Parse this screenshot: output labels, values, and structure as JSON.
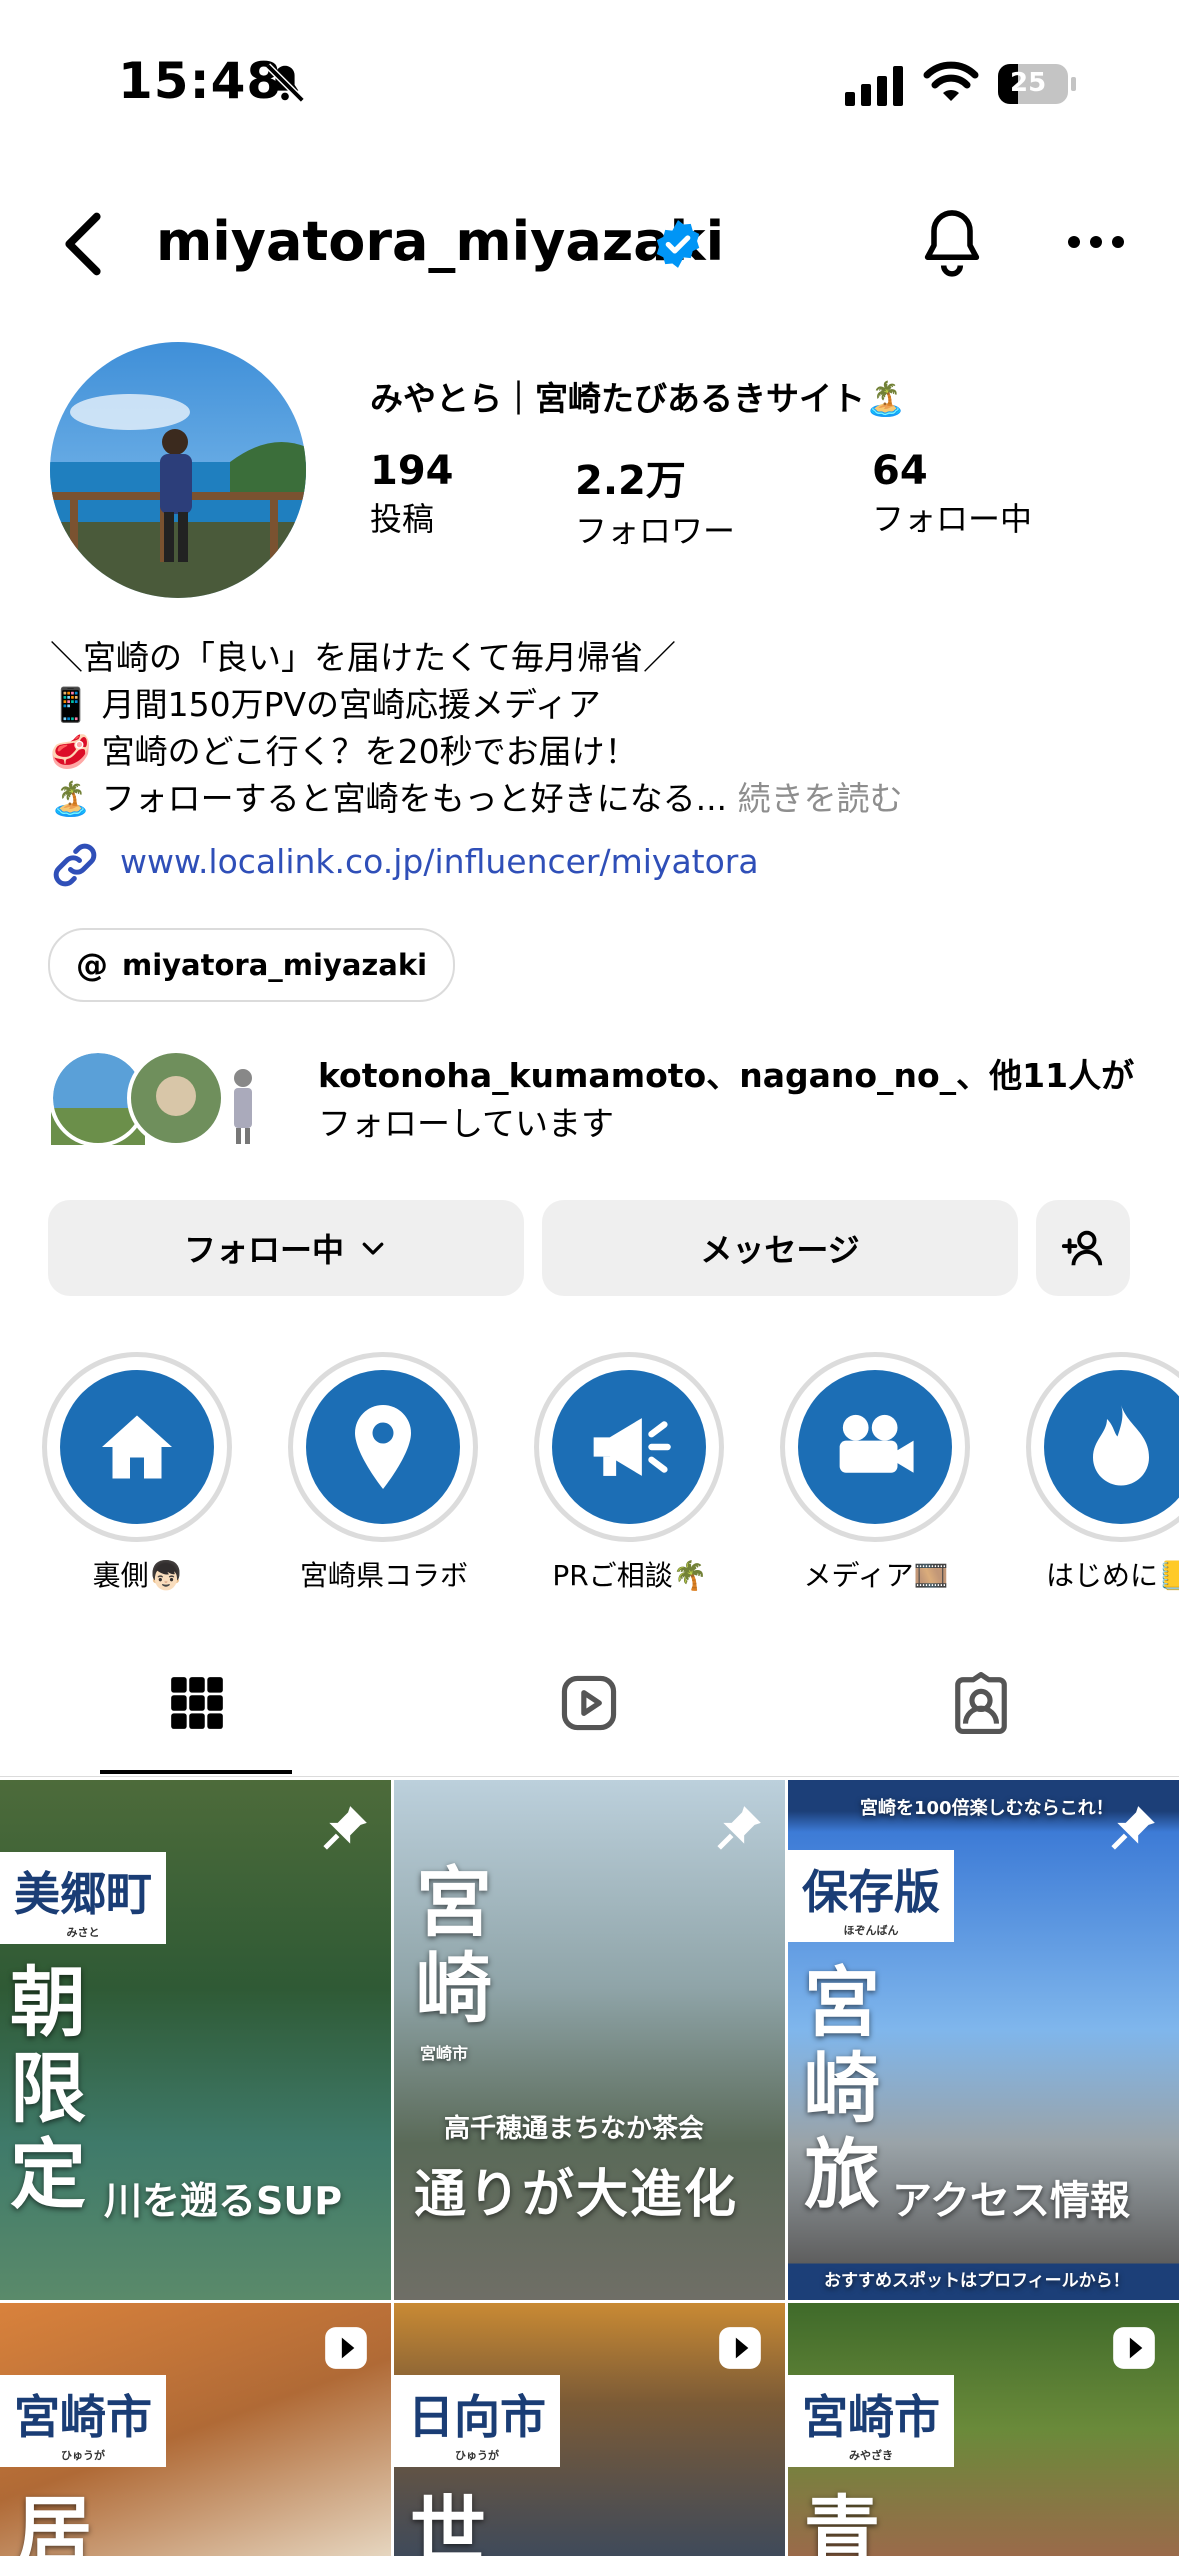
{
  "status_bar": {
    "time": "15:48",
    "battery": "25"
  },
  "header": {
    "username": "miyatora_miyazaki"
  },
  "profile": {
    "display_name": "みやとら｜宮崎たびあるきサイト🏝️",
    "stats": [
      {
        "value": "194",
        "label": "投稿"
      },
      {
        "value": "2.2万",
        "label": "フォロワー"
      },
      {
        "value": "64",
        "label": "フォロー中"
      }
    ],
    "bio_lines": [
      "＼宮崎の「良い」を届けたくて毎月帰省／",
      "📱 月間150万PVの宮崎応援メディア",
      "🥩 宮崎のどこ行く？を20秒でお届け！",
      "🏝️ フォローすると宮崎をもっと好きになる..."
    ],
    "bio_more": "続きを読む",
    "link": "www.localink.co.jp/influencer/miyatora",
    "threads_handle": "miyatora_miyazaki",
    "mutual_line1": "kotonoha_kumamoto、nagano_no_、他11人が",
    "mutual_line2": "フォローしています"
  },
  "buttons": {
    "following": "フォロー中",
    "message": "メッセージ"
  },
  "highlights": [
    {
      "label": "裏側👦🏻",
      "icon": "home-icon"
    },
    {
      "label": "宮崎県コラボ",
      "icon": "location-pin-icon"
    },
    {
      "label": "PRご相談🌴",
      "icon": "megaphone-icon"
    },
    {
      "label": "メディア🎞️",
      "icon": "video-camera-icon"
    },
    {
      "label": "はじめに📒",
      "icon": "fire-icon"
    }
  ],
  "tabs": [
    {
      "name": "grid",
      "icon": "grid-icon"
    },
    {
      "name": "reels",
      "icon": "reels-icon"
    },
    {
      "name": "tagged",
      "icon": "tagged-icon"
    }
  ],
  "grid": [
    {
      "kicker": "美郷町",
      "kicker_reading": "みさと",
      "big": "朝限定",
      "sub": "川を遡るSUP",
      "badge": "pin"
    },
    {
      "kicker": "宮崎",
      "kicker_reading": "宮崎市",
      "big": "",
      "sub_top": "高千穂通まちなか茶会",
      "sub": "通りが大進化",
      "badge": "pin"
    },
    {
      "top_text": "宮崎を100倍楽しむならこれ！",
      "kicker": "保存版",
      "kicker_reading": "ほぞんばん",
      "big": "宮崎旅",
      "sub": "アクセス情報",
      "bottom_text": "おすすめスポットはプロフィールから！",
      "badge": "pin"
    },
    {
      "kicker": "宮崎市",
      "kicker_reading": "ひゅうが",
      "big": "居",
      "badge": "reel"
    },
    {
      "kicker": "日向市",
      "kicker_reading": "ひゅうが",
      "big": "世",
      "badge": "reel"
    },
    {
      "kicker": "宮崎市",
      "kicker_reading": "みやざき",
      "big": "青",
      "badge": "reel"
    }
  ],
  "colors": {
    "accent": "#1c6eb5",
    "verified": "#0095f6",
    "link": "#2f4fb8"
  }
}
